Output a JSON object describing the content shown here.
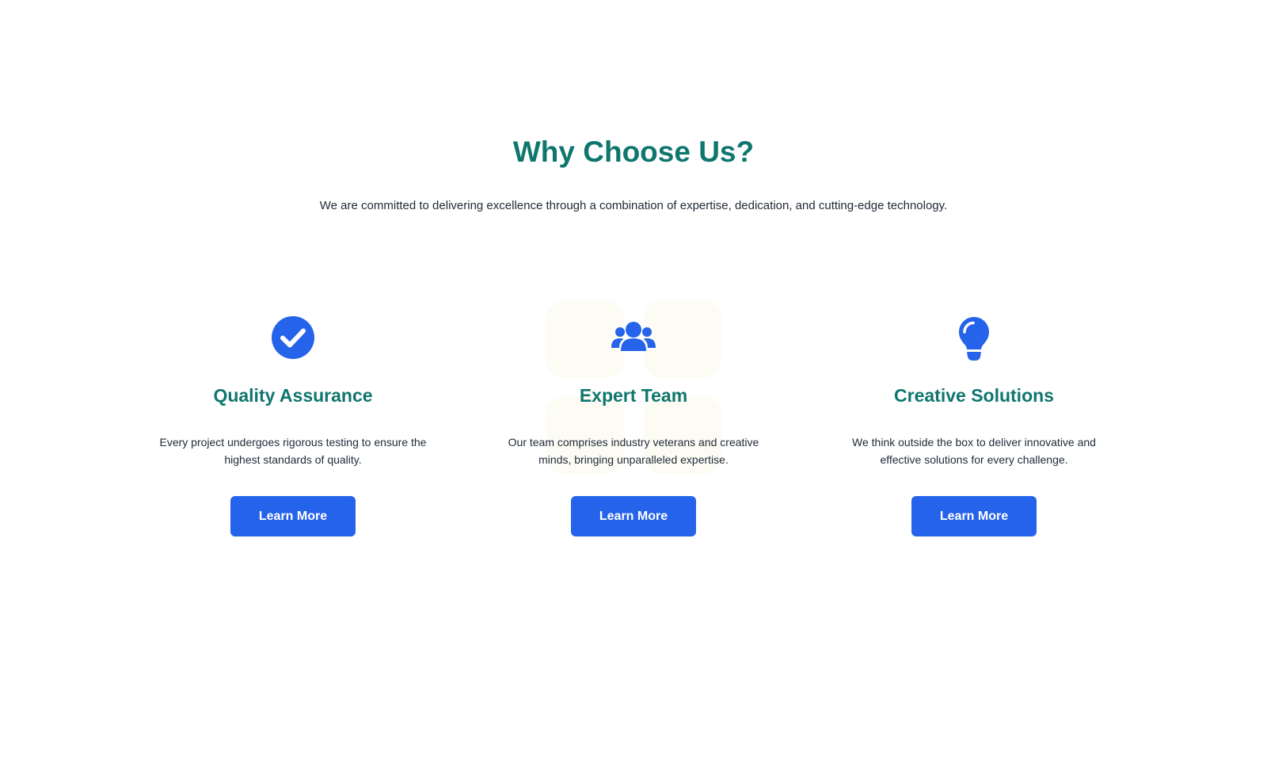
{
  "section": {
    "title": "Why Choose Us?",
    "subtitle": "We are committed to delivering excellence through a combination of expertise, dedication, and cutting-edge technology."
  },
  "colors": {
    "heading": "#0f766e",
    "accent": "#2563eb",
    "text": "#1f2937",
    "decor": "#fdfcf4"
  },
  "cards": [
    {
      "icon": "check-circle-icon",
      "title": "Quality Assurance",
      "text": "Every project undergoes rigorous testing to ensure the highest standards of quality.",
      "button": "Learn More"
    },
    {
      "icon": "users-icon",
      "title": "Expert Team",
      "text": "Our team comprises industry veterans and creative minds, bringing unparalleled expertise.",
      "button": "Learn More"
    },
    {
      "icon": "lightbulb-icon",
      "title": "Creative Solutions",
      "text": "We think outside the box to deliver innovative and effective solutions for every challenge.",
      "button": "Learn More"
    }
  ]
}
